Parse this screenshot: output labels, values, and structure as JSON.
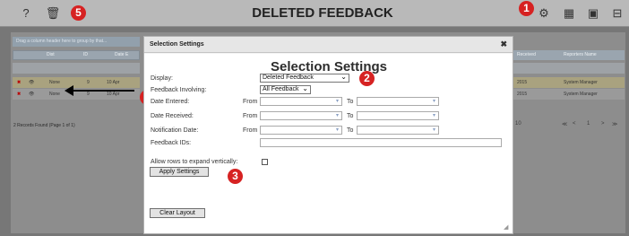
{
  "toolbar": {
    "title": "DELETED FEEDBACK",
    "badge_left": "5",
    "badge_right": "1",
    "icons": [
      "help-icon",
      "trash-icon",
      "settings-icon",
      "columns-icon",
      "export-icon",
      "layout-icon"
    ]
  },
  "grid": {
    "group_hint": "Drag a column header here to group by that...",
    "columns": [
      "Dist",
      "ID",
      "Date E"
    ],
    "right_columns": [
      "Received",
      "Reporters Name"
    ],
    "rows": [
      {
        "dist": "None",
        "id": "9",
        "date": "10 Apr",
        "received": "2015",
        "reporter": "System Manager"
      },
      {
        "dist": "None",
        "id": "9",
        "date": "10 Apr",
        "received": "2015",
        "reporter": "System Manager"
      }
    ],
    "records": "2 Records Found (Page 1 of 1)",
    "page_size": "10",
    "page_number": "1",
    "pager_first": "≪",
    "pager_prev": "<",
    "pager_next": ">",
    "pager_last": "≫"
  },
  "dialog": {
    "title": "Selection Settings",
    "close": "✖",
    "heading": "Selection Settings",
    "display_label": "Display:",
    "display_value": "Deleted Feedback",
    "involving_label": "Feedback Involving:",
    "involving_value": "All Feedback",
    "date_entered_label": "Date Entered:",
    "date_received_label": "Date Received:",
    "notification_label": "Notification Date:",
    "from_label": "From",
    "to_label": "To",
    "feedback_ids_label": "Feedback IDs:",
    "expand_label": "Allow rows to expand vertically:",
    "apply_button": "Apply Settings",
    "clear_button": "Clear Layout"
  },
  "badges": {
    "display": "2",
    "apply": "3",
    "grid": "4"
  }
}
